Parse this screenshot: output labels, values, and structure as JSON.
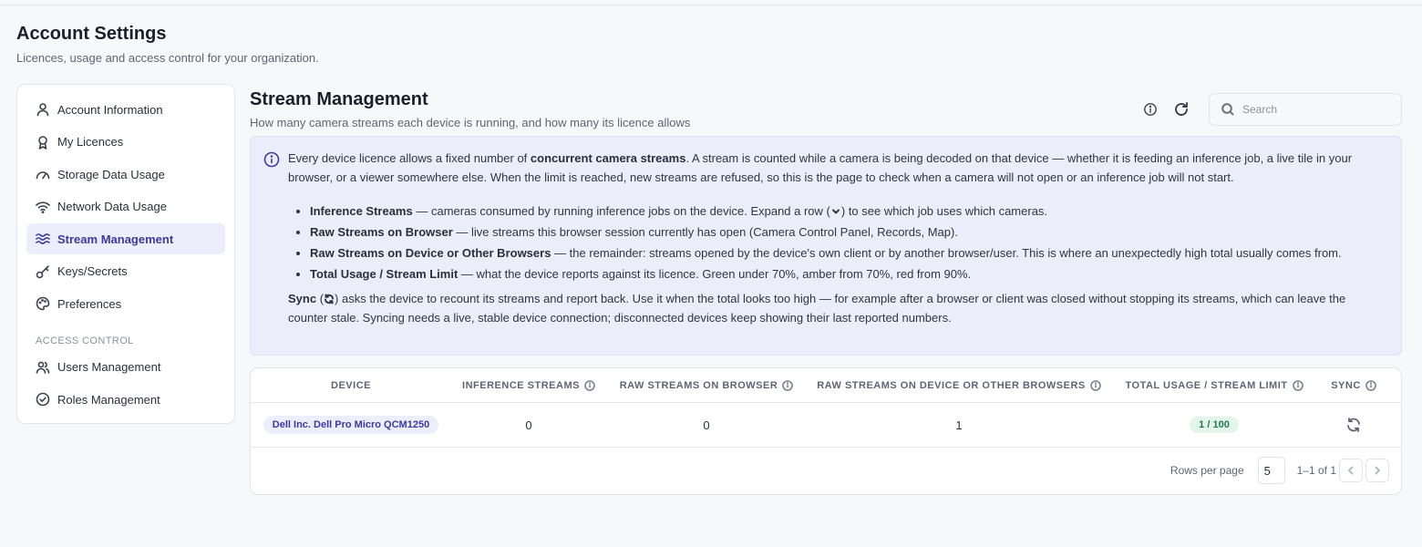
{
  "page": {
    "title": "Account Settings",
    "subtitle": "Licences, usage and access control for your organization."
  },
  "sidebar": {
    "items": [
      {
        "label": "Account Information",
        "icon": "user-icon"
      },
      {
        "label": "My Licences",
        "icon": "badge-icon"
      },
      {
        "label": "Storage Data Usage",
        "icon": "gauge-icon"
      },
      {
        "label": "Network Data Usage",
        "icon": "wifi-icon"
      },
      {
        "label": "Stream Management",
        "icon": "waves-icon",
        "active": true
      },
      {
        "label": "Keys/Secrets",
        "icon": "key-icon"
      },
      {
        "label": "Preferences",
        "icon": "palette-icon"
      }
    ],
    "section_label": "ACCESS CONTROL",
    "access_items": [
      {
        "label": "Users Management",
        "icon": "users-icon"
      },
      {
        "label": "Roles Management",
        "icon": "check-circle-icon"
      }
    ]
  },
  "main": {
    "title": "Stream Management",
    "subtitle": "How many camera streams each device is running, and how many its licence allows",
    "search_placeholder": "Search"
  },
  "info": {
    "intro_pre": "Every device licence allows a fixed number of ",
    "intro_bold": "concurrent camera streams",
    "intro_post": ". A stream is counted while a camera is being decoded on that device — whether it is feeding an inference job, a live tile in your browser, or a viewer somewhere else. When the limit is reached, new streams are refused, so this is the page to check when a camera will not open or an inference job will not start.",
    "bullets": [
      {
        "term": "Inference Streams",
        "pre": " — cameras consumed by running inference jobs on the device. Expand a row (",
        "post": ") to see which job uses which cameras."
      },
      {
        "term": "Raw Streams on Browser",
        "text": " — live streams this browser session currently has open (Camera Control Panel, Records, Map)."
      },
      {
        "term": "Raw Streams on Device or Other Browsers",
        "text": " — the remainder: streams opened by the device's own client or by another browser/user. This is where an unexpectedly high total usually comes from."
      },
      {
        "term": "Total Usage / Stream Limit",
        "text": " — what the device reports against its licence. Green under 70%, amber from 70%, red from 90%."
      }
    ],
    "sync_term": "Sync",
    "sync_pre": " (",
    "sync_post": ") asks the device to recount its streams and report back. Use it when the total looks too high — for example after a browser or client was closed without stopping its streams, which can leave the counter stale. Syncing needs a live, stable device connection; disconnected devices keep showing their last reported numbers."
  },
  "table": {
    "headers": [
      "DEVICE",
      "INFERENCE STREAMS",
      "RAW STREAMS ON BROWSER",
      "RAW STREAMS ON DEVICE OR OTHER BROWSERS",
      "TOTAL USAGE / STREAM LIMIT",
      "SYNC"
    ],
    "rows": [
      {
        "device": "Dell Inc. Dell Pro Micro QCM1250",
        "inference": "0",
        "raw_browser": "0",
        "raw_other": "1",
        "usage": "1 / 100",
        "usage_color": "#1f7a4b"
      }
    ],
    "rows_per_page_label": "Rows per page",
    "rows_per_page": "5",
    "range": "1–1 of 1"
  }
}
